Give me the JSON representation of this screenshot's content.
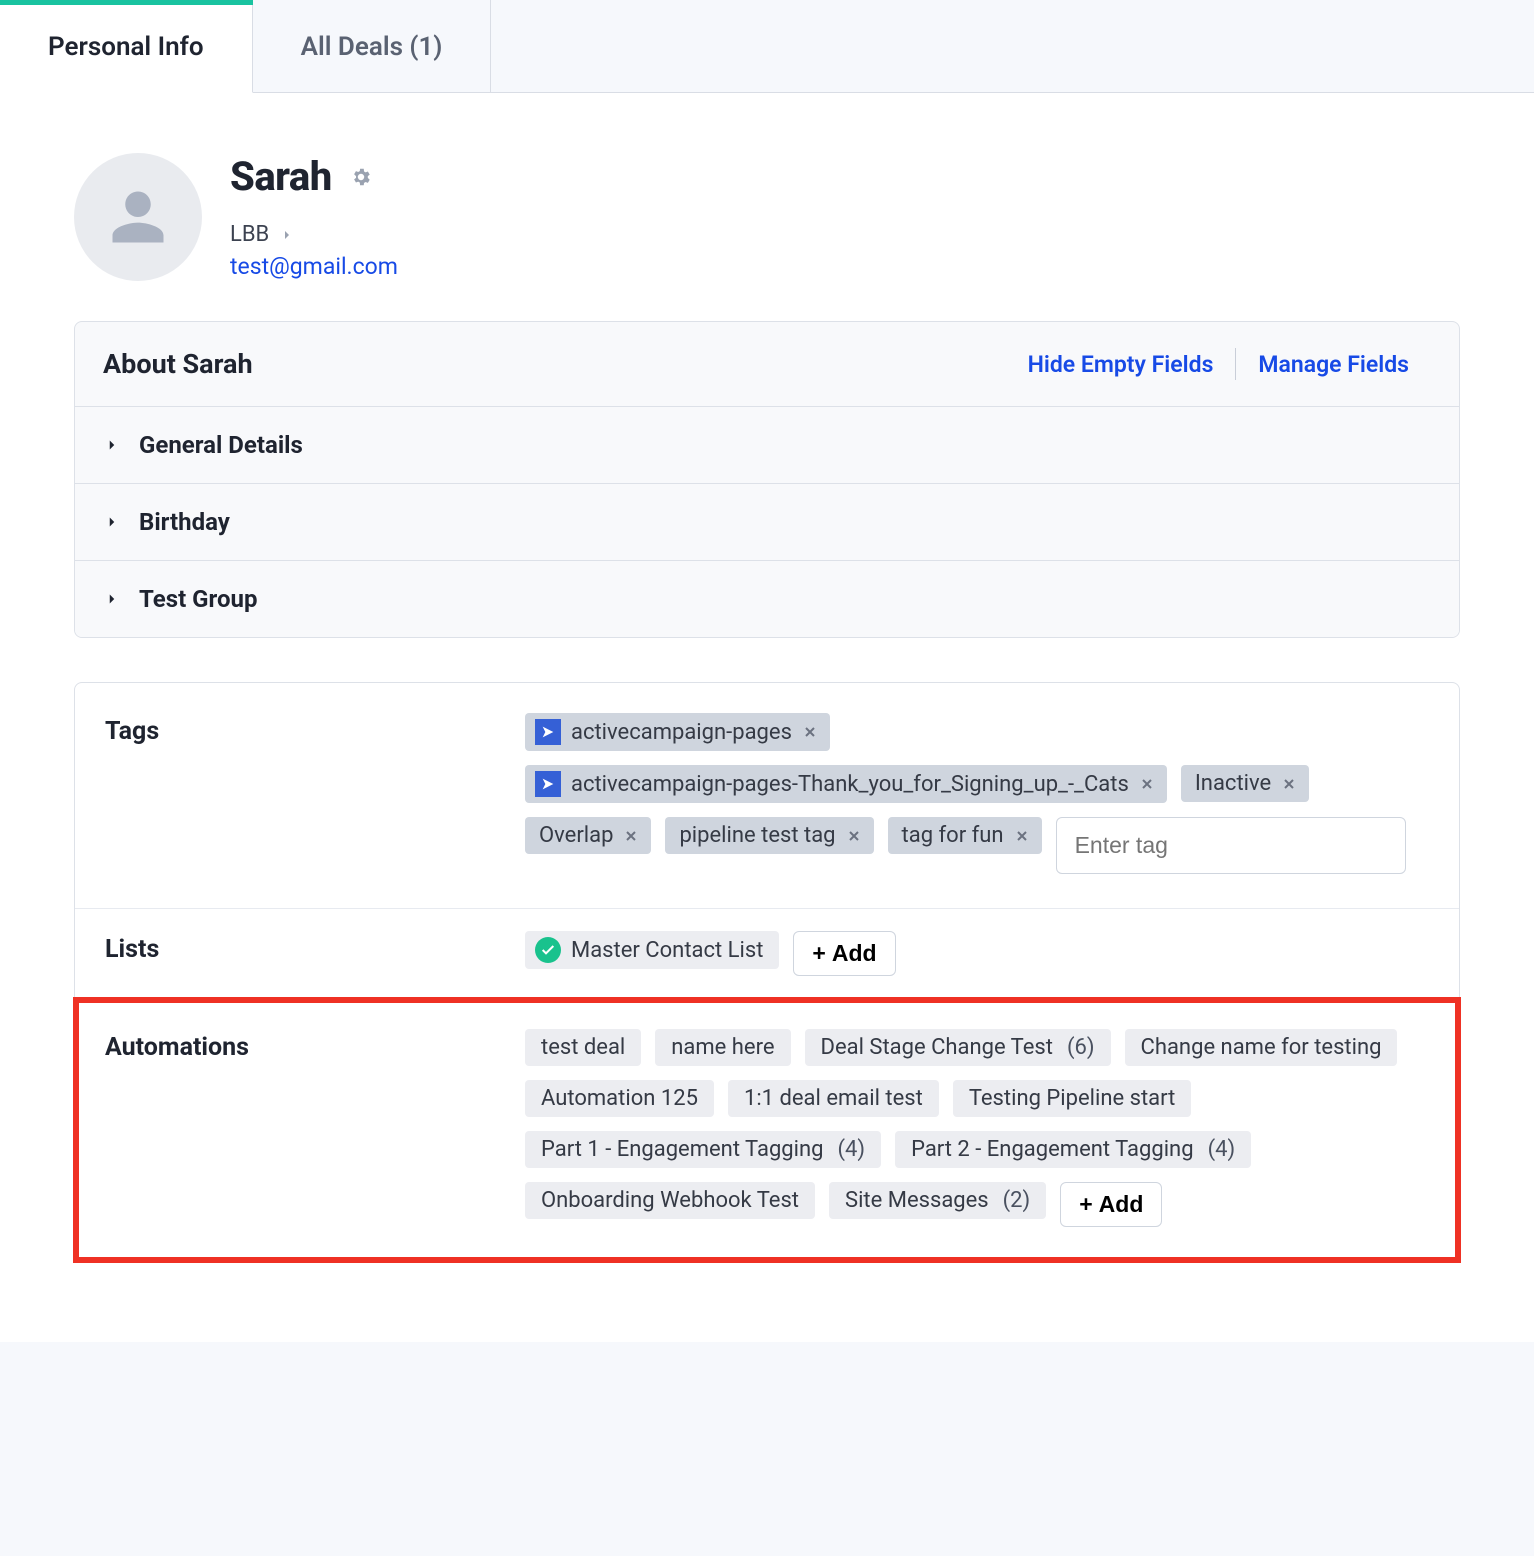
{
  "tabs": {
    "personal_info": "Personal Info",
    "all_deals": "All Deals (1)"
  },
  "contact": {
    "name": "Sarah",
    "company": "LBB",
    "email": "test@gmail.com"
  },
  "about": {
    "title": "About Sarah",
    "hide_empty": "Hide Empty Fields",
    "manage": "Manage Fields",
    "rows": {
      "general": "General Details",
      "birthday": "Birthday",
      "test_group": "Test Group"
    }
  },
  "tags": {
    "label": "Tags",
    "placeholder": "Enter tag",
    "items": {
      "t0": "activecampaign-pages",
      "t1": "activecampaign-pages-Thank_you_for_Signing_up_-_Cats",
      "t2": "Inactive",
      "t3": "Overlap",
      "t4": "pipeline test tag",
      "t5": "tag for fun"
    }
  },
  "lists": {
    "label": "Lists",
    "items": {
      "l0": "Master Contact List"
    },
    "add": "Add"
  },
  "automations": {
    "label": "Automations",
    "add": "Add",
    "items": {
      "a0": {
        "name": "test deal",
        "count": ""
      },
      "a1": {
        "name": "name here",
        "count": ""
      },
      "a2": {
        "name": "Deal Stage Change Test",
        "count": "(6)"
      },
      "a3": {
        "name": "Change name for testing",
        "count": ""
      },
      "a4": {
        "name": "Automation 125",
        "count": ""
      },
      "a5": {
        "name": "1:1 deal email test",
        "count": ""
      },
      "a6": {
        "name": "Testing Pipeline start",
        "count": ""
      },
      "a7": {
        "name": "Part 1 - Engagement Tagging",
        "count": "(4)"
      },
      "a8": {
        "name": "Part 2 - Engagement Tagging",
        "count": "(4)"
      },
      "a9": {
        "name": "Onboarding Webhook Test",
        "count": ""
      },
      "a10": {
        "name": "Site Messages",
        "count": "(2)"
      }
    }
  }
}
